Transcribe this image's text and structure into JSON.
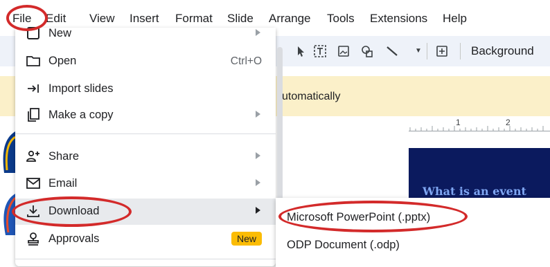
{
  "menubar": {
    "items": [
      "File",
      "Edit",
      "View",
      "Insert",
      "Format",
      "Slide",
      "Arrange",
      "Tools",
      "Extensions",
      "Help"
    ]
  },
  "toolbar": {
    "background_label": "Background"
  },
  "banner": {
    "text": "utomatically"
  },
  "ruler": {
    "labels": [
      "1",
      "2"
    ]
  },
  "slide": {
    "title": "What is an event"
  },
  "file_menu": {
    "items": [
      {
        "label": "New",
        "icon": "new-icon",
        "submenu": true
      },
      {
        "label": "Open",
        "icon": "folder-icon",
        "shortcut": "Ctrl+O"
      },
      {
        "label": "Import slides",
        "icon": "import-arrow-icon"
      },
      {
        "label": "Make a copy",
        "icon": "copy-icon",
        "submenu": true
      },
      {
        "label": "Share",
        "icon": "share-person-add-icon",
        "submenu": true
      },
      {
        "label": "Email",
        "icon": "email-icon",
        "submenu": true
      },
      {
        "label": "Download",
        "icon": "download-icon",
        "submenu": true,
        "highlighted": true
      },
      {
        "label": "Approvals",
        "icon": "approvals-stamp-icon",
        "badge": "New"
      }
    ]
  },
  "download_submenu": {
    "items": [
      "Microsoft PowerPoint (.pptx)",
      "ODP Document (.odp)"
    ]
  },
  "colors": {
    "annotation_red": "#d32a2a",
    "badge_yellow": "#fbbc04",
    "banner_yellow": "#fbf0c9",
    "slide_navy": "#0b1a5e"
  }
}
